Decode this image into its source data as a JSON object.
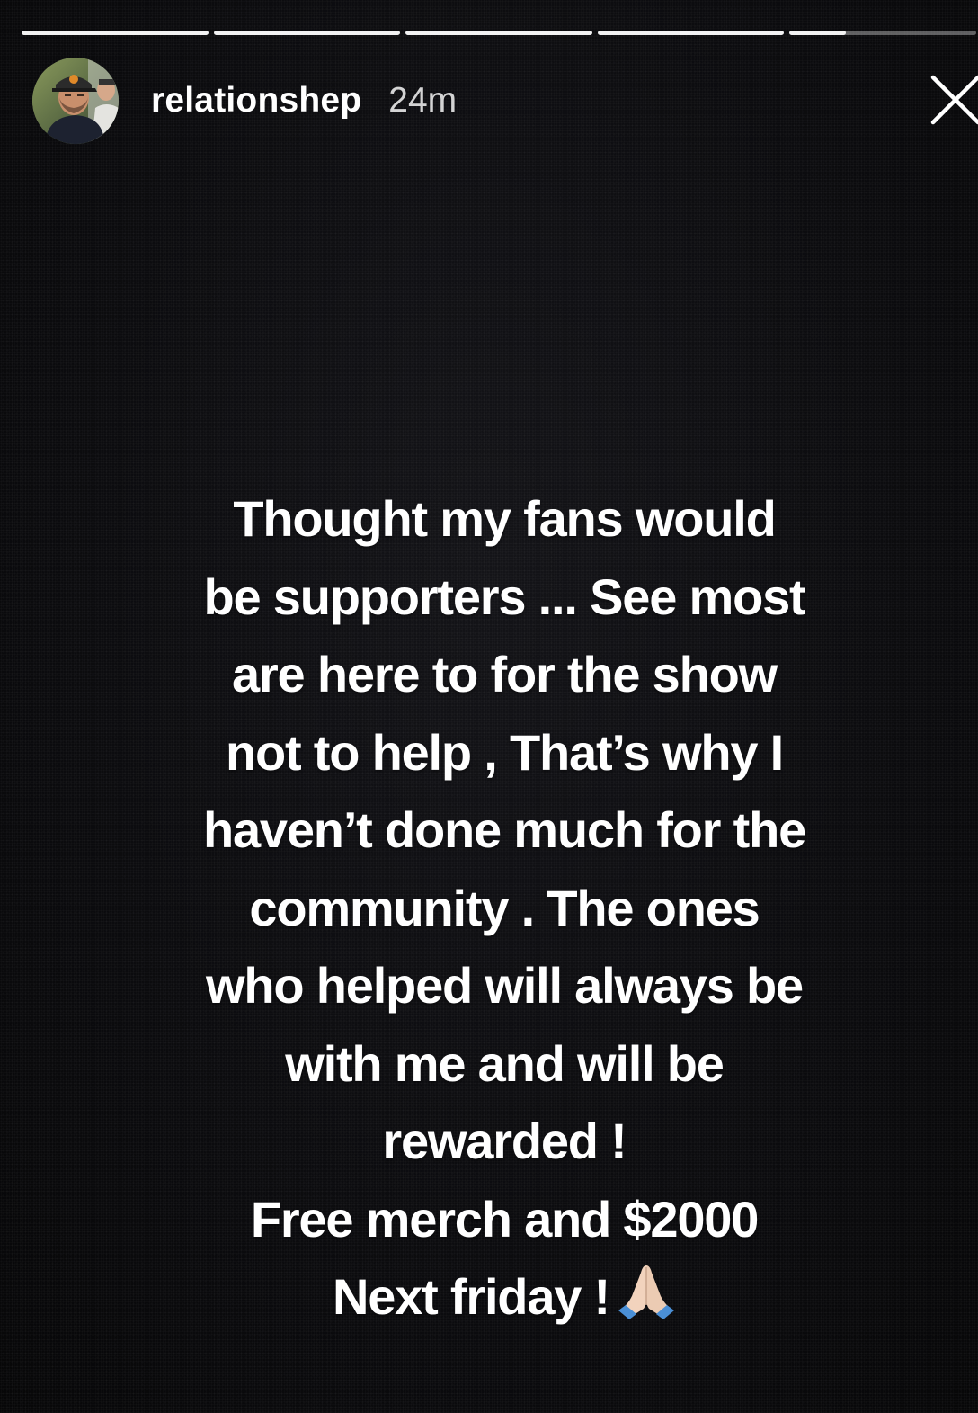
{
  "story": {
    "progress_segments": [
      {
        "fill_fraction": 1.0
      },
      {
        "fill_fraction": 1.0
      },
      {
        "fill_fraction": 1.0
      },
      {
        "fill_fraction": 1.0
      },
      {
        "fill_fraction": 0.3
      }
    ],
    "header": {
      "avatar_icon": "profile-photo",
      "username": "relationshep",
      "timestamp": "24m",
      "close_icon": "close-icon"
    },
    "caption": {
      "lines": [
        "Thought my fans would",
        "be supporters ... See most",
        "are here to for the show",
        "not to help , That’s why I",
        "haven’t done much for the",
        "community . The ones",
        "who helped will always be",
        "with me and will be",
        "rewarded !",
        "Free merch and $2000",
        "Next friday !"
      ],
      "trailing_emoji": "folded-hands-icon"
    },
    "colors": {
      "background": "#0c0c0f",
      "text": "#ffffff",
      "progress_track": "rgba(255,255,255,0.35)",
      "progress_fill": "rgba(255,255,255,0.92)"
    }
  }
}
